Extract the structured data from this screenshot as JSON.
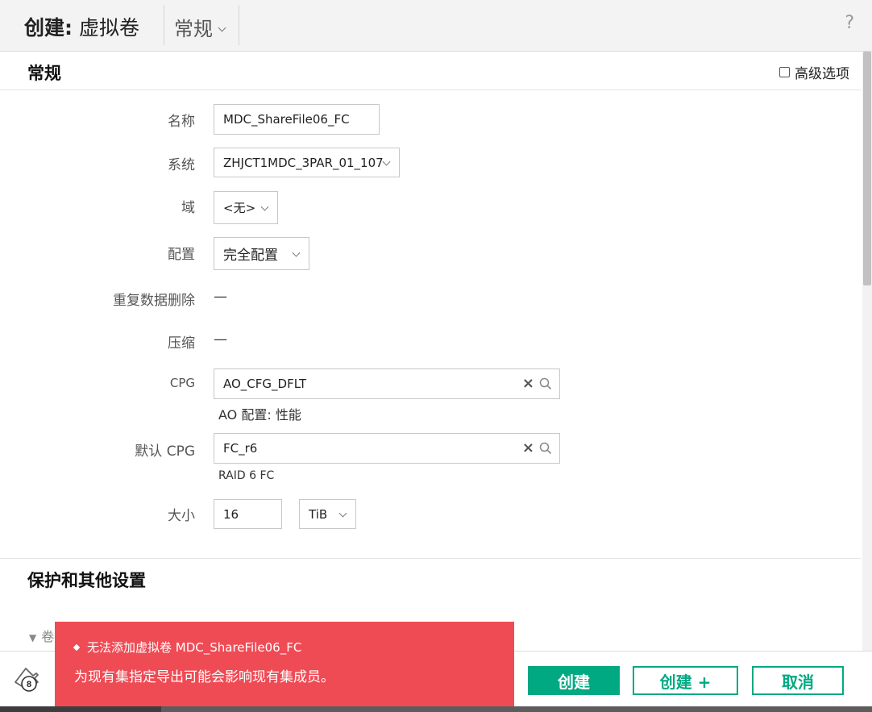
{
  "header": {
    "create_prefix": "创建:",
    "object_type": "虚拟卷",
    "view": "常规",
    "help": "?"
  },
  "general": {
    "title": "常规",
    "advanced_options": "高级选项",
    "name_label": "名称",
    "name_value": "MDC_ShareFile06_FC",
    "system_label": "系统",
    "system_value": "ZHJCT1MDC_3PAR_01_107",
    "domain_label": "域",
    "domain_value": "<无>",
    "provisioning_label": "配置",
    "provisioning_value": "完全配置",
    "dedup_label": "重复数据删除",
    "dedup_value": "—",
    "compression_label": "压缩",
    "compression_value": "—",
    "cpg_label": "CPG",
    "cpg_value": "AO_CFG_DFLT",
    "cpg_hint": "AO 配置: 性能",
    "default_cpg_label": "默认 CPG",
    "default_cpg_value": "FC_r6",
    "default_cpg_hint": "RAID 6 FC",
    "size_label": "大小",
    "size_value": "16",
    "size_unit": "TiB"
  },
  "protection": {
    "title": "保护和其他设置",
    "collapsed_item": "卷"
  },
  "footer": {
    "notification_count": "8",
    "create": "创建",
    "create_plus": "创建 +",
    "cancel": "取消"
  },
  "toast": {
    "title": "无法添加虚拟卷 MDC_ShareFile06_FC",
    "message": "为现有集指定导出可能会影响现有集成员。"
  },
  "colors": {
    "accent": "#01a982",
    "error": "#ef4b55",
    "header_bg": "#f3f3f3"
  },
  "icons": [
    "chevron-down-icon",
    "help-icon",
    "checkbox-icon",
    "clear-icon",
    "search-icon",
    "triangle-down-icon",
    "notification-bell-icon",
    "diamond-bullet-icon"
  ]
}
